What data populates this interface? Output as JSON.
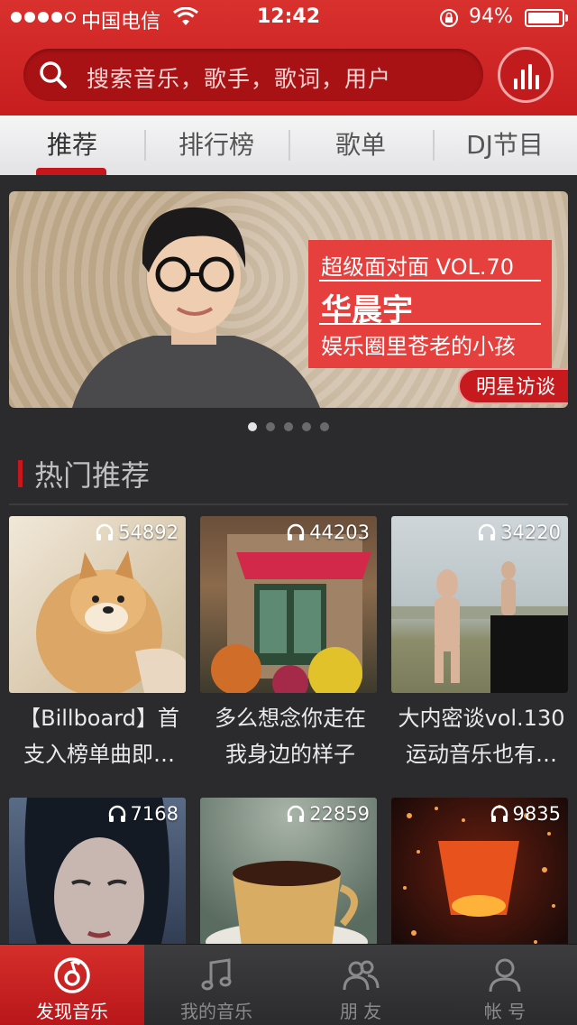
{
  "status_bar": {
    "carrier": "中国电信",
    "time": "12:42",
    "battery": "94%"
  },
  "search": {
    "placeholder": "搜索音乐，歌手，歌词，用户"
  },
  "tabs": [
    {
      "label": "推荐",
      "active": true
    },
    {
      "label": "排行榜",
      "active": false
    },
    {
      "label": "歌单",
      "active": false
    },
    {
      "label": "DJ节目",
      "active": false
    }
  ],
  "banner": {
    "kicker": "超级面对面 VOL.70",
    "name": "华晨宇",
    "description": "娱乐圈里苍老的小孩",
    "tag": "明星访谈",
    "pages": 5,
    "current_page": 1
  },
  "section": {
    "title": "热门推荐"
  },
  "playlists": [
    {
      "count": "54892",
      "title_line1": "【Billboard】首",
      "title_line2": "支入榜单曲即…"
    },
    {
      "count": "44203",
      "title_line1": "多么想念你走在",
      "title_line2": "我身边的样子"
    },
    {
      "count": "34220",
      "title_line1": "大内密谈vol.130",
      "title_line2": "运动音乐也有…"
    },
    {
      "count": "7168",
      "title_line1": "",
      "title_line2": ""
    },
    {
      "count": "22859",
      "title_line1": "",
      "title_line2": ""
    },
    {
      "count": "9835",
      "title_line1": "",
      "title_line2": ""
    }
  ],
  "bottom_nav": [
    {
      "label": "发现音乐",
      "active": true
    },
    {
      "label": "我的音乐",
      "active": false
    },
    {
      "label": "朋 友",
      "active": false
    },
    {
      "label": "帐 号",
      "active": false
    }
  ],
  "colors": {
    "brand_red": "#c8161d",
    "background": "#2b2b2d"
  }
}
